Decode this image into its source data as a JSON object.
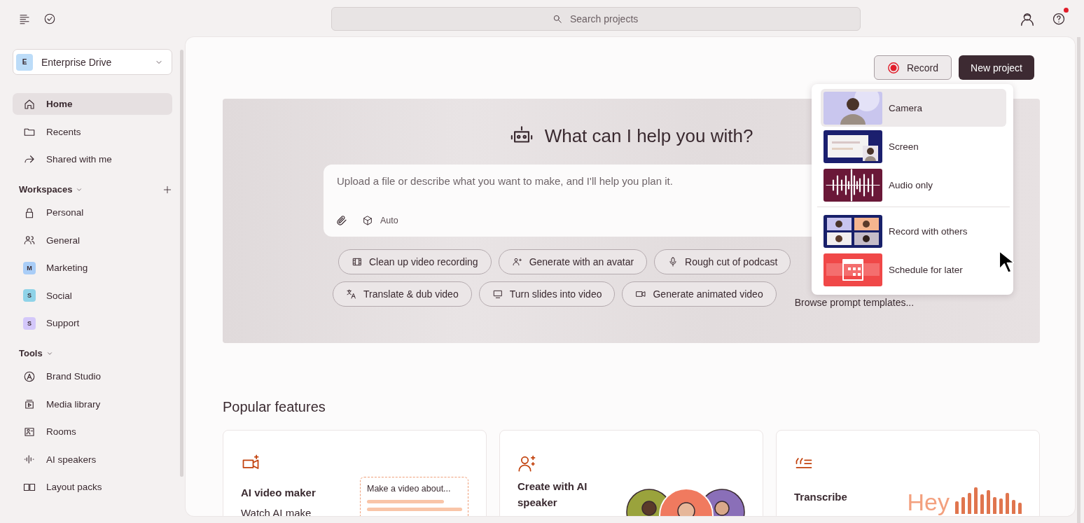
{
  "top_bar": {
    "search": {
      "placeholder": "Search projects"
    },
    "notification": true
  },
  "sidebar": {
    "drive": {
      "initial": "E",
      "name": "Enterprise Drive"
    },
    "nav": [
      {
        "label": "Home",
        "selected": true
      },
      {
        "label": "Recents",
        "selected": false
      },
      {
        "label": "Shared with me",
        "selected": false
      }
    ],
    "workspaces": {
      "title": "Workspaces",
      "items": [
        {
          "kind": "icon",
          "label": "Personal"
        },
        {
          "kind": "icon",
          "label": "General"
        },
        {
          "kind": "badge",
          "initial": "M",
          "label": "Marketing",
          "color": "#a9cdf7"
        },
        {
          "kind": "badge",
          "initial": "S",
          "label": "Social",
          "color": "#8fd3e8"
        },
        {
          "kind": "badge",
          "initial": "S",
          "label": "Support",
          "color": "#d4c8fa"
        }
      ]
    },
    "tools": {
      "title": "Tools",
      "items": [
        {
          "label": "Brand Studio"
        },
        {
          "label": "Media library"
        },
        {
          "label": "Rooms"
        },
        {
          "label": "AI speakers"
        },
        {
          "label": "Layout packs"
        }
      ]
    }
  },
  "actions": {
    "record": "Record",
    "new_project": "New project"
  },
  "record_menu": {
    "groups": [
      [
        {
          "label": "Camera",
          "selected": true
        },
        {
          "label": "Screen",
          "selected": false
        },
        {
          "label": "Audio only",
          "selected": false
        }
      ],
      [
        {
          "label": "Record with others",
          "selected": false
        },
        {
          "label": "Schedule for later",
          "selected": false
        }
      ]
    ]
  },
  "hero": {
    "title": "What can I help you with?",
    "prompt": {
      "placeholder": "Upload a file or describe what you want to make, and I'll help you plan it."
    },
    "model": "Auto",
    "chips": [
      [
        {
          "label": "Clean up video recording"
        },
        {
          "label": "Generate with an avatar"
        },
        {
          "label": "Rough cut of podcast"
        }
      ],
      [
        {
          "label": "Translate & dub video"
        },
        {
          "label": "Turn slides into video"
        },
        {
          "label": "Generate animated video"
        }
      ]
    ],
    "browse": "Browse prompt templates..."
  },
  "popular": {
    "title": "Popular features",
    "cards": [
      {
        "kind": "video",
        "title": "AI video maker",
        "text": "Watch AI make",
        "sample": "Make a video about..."
      },
      {
        "kind": "speaker",
        "title": "Create with AI speaker"
      },
      {
        "kind": "transcribe",
        "title": "Transcribe",
        "sample": "Hey"
      }
    ]
  }
}
